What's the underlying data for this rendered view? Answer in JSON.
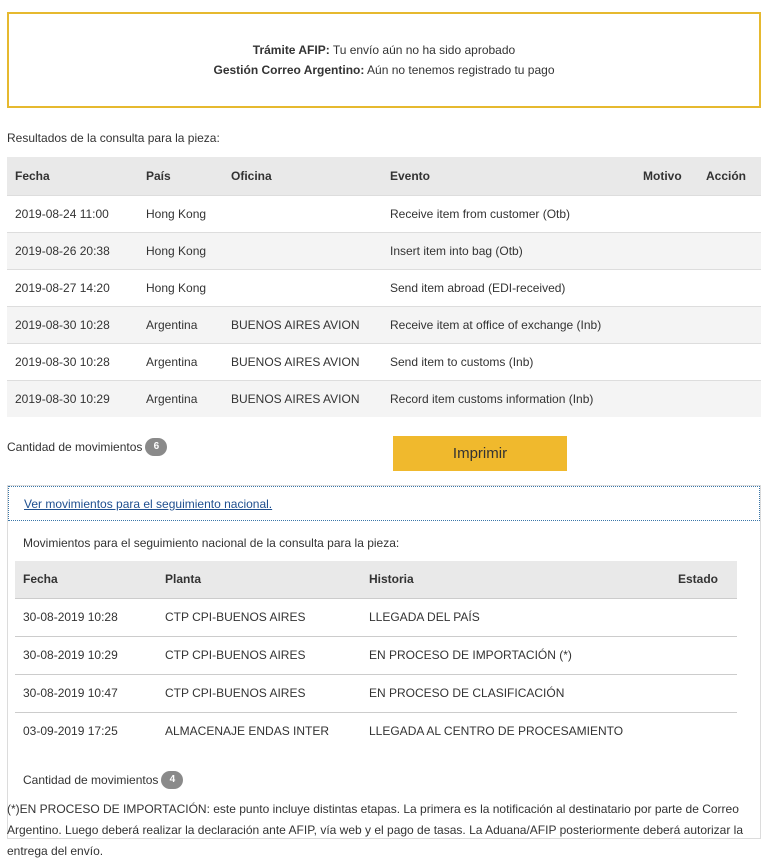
{
  "notice": {
    "afip_label": "Trámite AFIP:",
    "afip_text": " Tu envío aún no ha sido aprobado",
    "correo_label": "Gestión Correo Argentino:",
    "correo_text": " Aún no tenemos registrado tu pago"
  },
  "results_label": "Resultados de la consulta para la pieza:",
  "table1": {
    "headers": [
      "Fecha",
      "País",
      "Oficina",
      "Evento",
      "Motivo",
      "Acción"
    ],
    "rows": [
      [
        "2019-08-24 11:00",
        "Hong Kong",
        "",
        "Receive item from customer (Otb)",
        "",
        ""
      ],
      [
        "2019-08-26 20:38",
        "Hong Kong",
        "",
        "Insert item into bag (Otb)",
        "",
        ""
      ],
      [
        "2019-08-27 14:20",
        "Hong Kong",
        "",
        "Send item abroad (EDI-received)",
        "",
        ""
      ],
      [
        "2019-08-30 10:28",
        "Argentina",
        "BUENOS AIRES AVION",
        "Receive item at office of exchange (Inb)",
        "",
        ""
      ],
      [
        "2019-08-30 10:28",
        "Argentina",
        "BUENOS AIRES AVION",
        "Send item to customs (Inb)",
        "",
        ""
      ],
      [
        "2019-08-30 10:29",
        "Argentina",
        "BUENOS AIRES AVION",
        "Record item customs information (Inb)",
        "",
        ""
      ]
    ]
  },
  "count1": {
    "label": "Cantidad de movimientos",
    "value": "6"
  },
  "print_label": "Imprimir",
  "national": {
    "link_label": "Ver movimientos para el seguimiento nacional.",
    "label": "Movimientos para el seguimiento nacional de la consulta para la pieza:",
    "headers": [
      "Fecha",
      "Planta",
      "Historia",
      "Estado"
    ],
    "rows": [
      [
        "30-08-2019 10:28",
        "CTP CPI-BUENOS AIRES",
        "LLEGADA DEL PAÍS",
        ""
      ],
      [
        "30-08-2019 10:29",
        "CTP CPI-BUENOS AIRES",
        "EN PROCESO DE IMPORTACIÓN (*)",
        ""
      ],
      [
        "30-08-2019 10:47",
        "CTP CPI-BUENOS AIRES",
        "EN PROCESO DE CLASIFICACIÓN",
        ""
      ],
      [
        "03-09-2019 17:25",
        "ALMACENAJE ENDAS INTER",
        "LLEGADA AL CENTRO DE PROCESAMIENTO",
        ""
      ]
    ],
    "count_label": "Cantidad de movimientos",
    "count_value": "4"
  },
  "footnote": "(*)EN PROCESO DE IMPORTACIÓN: este punto incluye distintas etapas. La primera es la notificación al destinatario por parte de Correo Argentino. Luego deberá realizar la declaración ante AFIP, vía web y el pago de tasas. La Aduana/AFIP posteriormente deberá autorizar la entrega del envío.",
  "colors": {
    "accent": "#f0b92d",
    "notice_border": "#e6b92f",
    "link": "#1f4f8f",
    "badge": "#8a8a8a"
  }
}
